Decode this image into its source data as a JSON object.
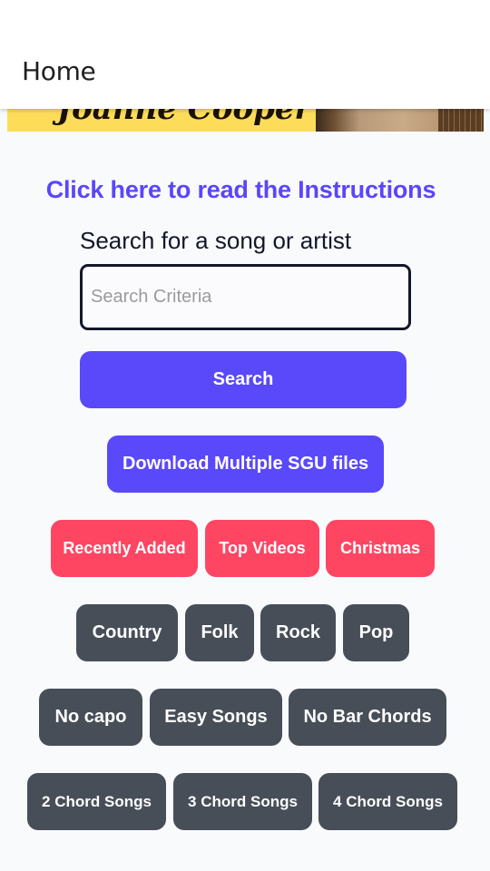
{
  "header": {
    "title": "Home"
  },
  "banner": {
    "text": "Joanne Cooper",
    "image": "artist-photo-banner"
  },
  "instructions_link": "Click here to read the Instructions",
  "search": {
    "label": "Search for a song or artist",
    "placeholder": "Search Criteria",
    "value": "",
    "button_label": "Search"
  },
  "download_button": "Download Multiple SGU files",
  "featured_buttons": [
    {
      "label": "Recently Added"
    },
    {
      "label": "Top Videos"
    },
    {
      "label": "Christmas"
    }
  ],
  "genre_buttons": [
    {
      "label": "Country"
    },
    {
      "label": "Folk"
    },
    {
      "label": "Rock"
    },
    {
      "label": "Pop"
    }
  ],
  "difficulty_buttons": [
    {
      "label": "No capo"
    },
    {
      "label": "Easy Songs"
    },
    {
      "label": "No Bar Chords"
    }
  ],
  "chord_count_buttons": [
    {
      "label": "2 Chord Songs"
    },
    {
      "label": "3 Chord Songs"
    },
    {
      "label": "4 Chord Songs"
    }
  ],
  "colors": {
    "primary": "#5a48fb",
    "featured": "#fe4663",
    "category": "#474e58",
    "link": "#5a46fa",
    "background": "#f9fafc"
  }
}
